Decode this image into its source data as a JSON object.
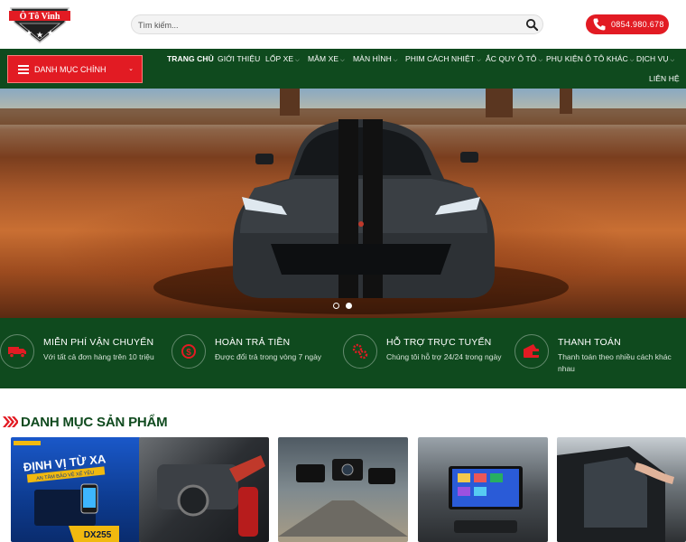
{
  "header": {
    "logo_text": "Ô Tô Vinh",
    "search": {
      "placeholder": "Tìm kiếm..."
    },
    "phone": "0854.980.678"
  },
  "nav": {
    "category_button": "DANH MỤC CHÍNH",
    "items": [
      {
        "label": "TRANG CHỦ",
        "dropdown": false
      },
      {
        "label": "GIỚI THIỆU",
        "dropdown": false
      },
      {
        "label": "LỐP XE",
        "dropdown": true
      },
      {
        "label": "MÂM XE",
        "dropdown": true
      },
      {
        "label": "MÀN HÌNH",
        "dropdown": true
      },
      {
        "label": "PHIM CÁCH NHIỆT",
        "dropdown": true
      },
      {
        "label": "ẮC QUY Ô TÔ",
        "dropdown": true
      },
      {
        "label": "PHỤ KIỆN Ô TÔ KHÁC",
        "dropdown": true
      },
      {
        "label": "DỊCH VỤ",
        "dropdown": true
      },
      {
        "label": "LIÊN HỆ",
        "dropdown": false
      }
    ]
  },
  "slider": {
    "count": 2,
    "active": 1
  },
  "features": [
    {
      "icon": "truck-icon",
      "title": "MIỄN PHÍ VẬN CHUYỂN",
      "desc": "Với tất cả đơn hàng trên 10 triệu"
    },
    {
      "icon": "refund-icon",
      "title": "HOÀN TRẢ TIỀN",
      "desc": "Được đổi trả trong vòng 7 ngày"
    },
    {
      "icon": "gears-icon",
      "title": "HỖ TRỢ TRỰC TUYẾN",
      "desc": "Chúng tôi hỗ trợ 24/24 trong ngày"
    },
    {
      "icon": "payment-icon",
      "title": "THANH TOÁN",
      "desc": "Thanh toán theo nhiều cách khác nhau"
    }
  ],
  "section": {
    "title": "DANH MỤC SẢN PHẨM"
  },
  "products": {
    "first_banner_text": "ĐỊNH VỊ TỪ XA",
    "first_banner_sub": "AN TÂM BẢO VỆ XẾ YÊU",
    "first_banner_model": "DX255"
  },
  "colors": {
    "primary_green": "#0f4a1e",
    "accent_red": "#e21b23"
  }
}
